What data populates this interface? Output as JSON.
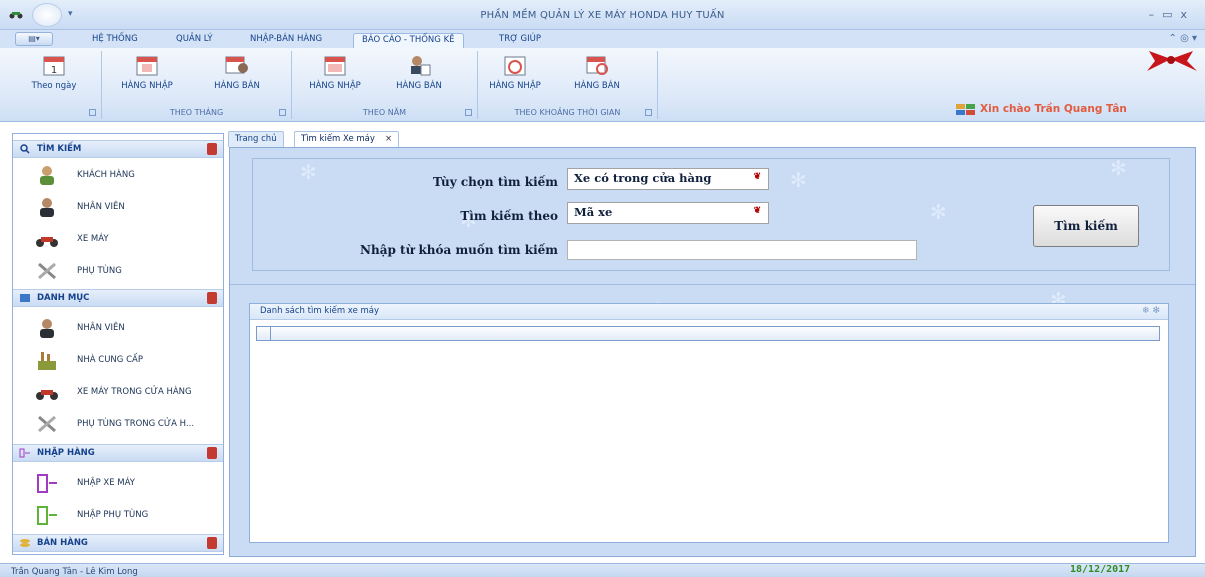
{
  "window": {
    "title": "PHẦN MỀM QUẢN LÝ XE MÁY HONDA HUY TUẤN"
  },
  "ribbon_tabs": [
    "HỆ THỐNG",
    "QUẢN LÝ",
    "NHẬP-BÁN HÀNG",
    "BÁO CÁO - THỐNG KÊ",
    "TRỢ GIÚP"
  ],
  "ribbon": {
    "groups": [
      {
        "label": "",
        "buttons": [
          "Theo ngày"
        ]
      },
      {
        "label": "THEO THÁNG",
        "buttons": [
          "HÀNG NHẬP",
          "HÀNG BÁN"
        ]
      },
      {
        "label": "THEO NĂM",
        "buttons": [
          "HÀNG NHẬP",
          "HÀNG BÁN"
        ]
      },
      {
        "label": "THEO KHOẢNG THỜI GIAN",
        "buttons": [
          "HÀNG NHẬP",
          "HÀNG BÁN"
        ]
      }
    ],
    "greeting": "Xin chào Trần Quang Tân"
  },
  "nav": {
    "groups": [
      {
        "title": "TÌM KIẾM",
        "items": [
          "KHÁCH HÀNG",
          "NHÂN VIÊN",
          "XE MÁY",
          "PHỤ TÙNG"
        ]
      },
      {
        "title": "DANH MỤC",
        "items": [
          "NHÂN VIÊN",
          "NHÀ CUNG CẤP",
          "XE MÁY TRONG CỬA HÀNG",
          "PHỤ TÙNG TRONG CỬA H..."
        ]
      },
      {
        "title": "NHẬP HÀNG",
        "items": [
          "NHẬP XE MÁY",
          "NHẬP PHỤ TÙNG"
        ]
      },
      {
        "title": "BÁN HÀNG",
        "items": []
      }
    ]
  },
  "doc_tabs": [
    "Trang chủ",
    "Tìm kiếm Xe máy"
  ],
  "search": {
    "option_label": "Tùy chọn tìm kiếm",
    "option_value": "Xe có trong cửa hàng",
    "by_label": "Tìm kiếm theo",
    "by_value": "Mã xe",
    "keyword_label": "Nhập từ khóa muốn tìm kiếm",
    "keyword_value": "",
    "button": "Tìm kiếm"
  },
  "results": {
    "caption": "Danh sách tìm kiếm xe máy"
  },
  "status": {
    "users": "Trần Quang Tân - Lê Kim Long",
    "date": "18/12/2017"
  },
  "colors": {
    "accent": "#15428b",
    "greeting": "#e35b3e",
    "date": "#2f8d24"
  }
}
